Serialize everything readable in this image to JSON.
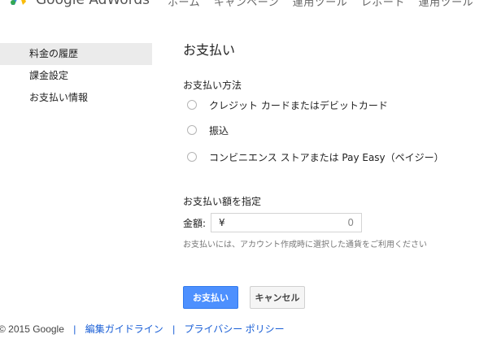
{
  "header": {
    "logo_text": "Google AdWords",
    "nav_items": [
      "ホーム",
      "キャンペーン",
      "運用ツール",
      "レポート",
      "運用ツール"
    ]
  },
  "sidebar": {
    "items": [
      {
        "label": "料金の履歴",
        "active": true
      },
      {
        "label": "課金設定",
        "active": false
      },
      {
        "label": "お支払い情報",
        "active": false
      }
    ]
  },
  "main": {
    "title": "お支払い",
    "payment_method_label": "お支払い方法",
    "payment_options": [
      {
        "label": "クレジット カードまたはデビットカード",
        "selected": false
      },
      {
        "label": "振込",
        "selected": false
      },
      {
        "label": "コンビニエンス ストアまたは Pay Easy（ペイジー）",
        "selected": false
      }
    ],
    "amount_section_label": "お支払い額を指定",
    "amount_label": "金額:",
    "currency_symbol": "¥",
    "amount_value": "0",
    "hint": "お支払いには、アカウント作成時に選択した通貨をご利用ください",
    "pay_button": "お支払い",
    "cancel_button": "キャンセル"
  },
  "footer": {
    "copyright": "© 2015 Google",
    "separator": "|",
    "link_guidelines": "編集ガイドライン",
    "link_privacy": "プライバシー ポリシー"
  },
  "colors": {
    "primary_button": "#4d90fe",
    "link": "#1a5fd6",
    "sidebar_active_bg": "#ebebeb"
  }
}
